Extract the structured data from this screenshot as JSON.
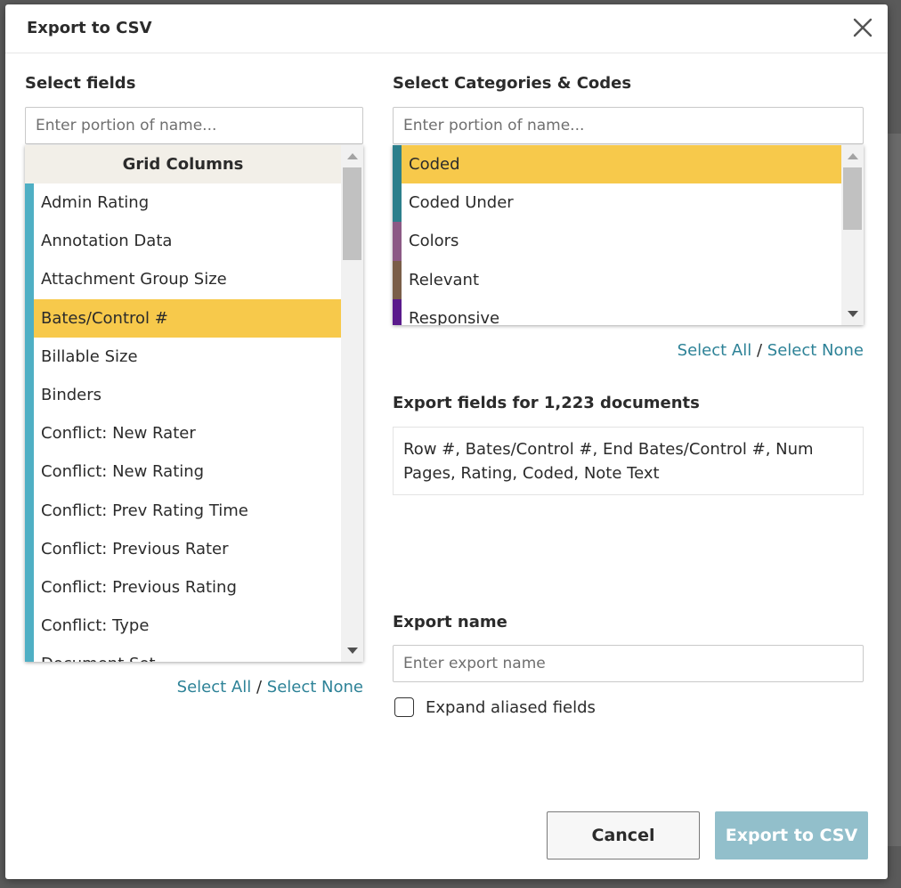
{
  "dialog": {
    "title": "Export to CSV",
    "close_icon": "close-icon"
  },
  "fields": {
    "label": "Select fields",
    "search_placeholder": "Enter portion of name...",
    "group_header": "Grid Columns",
    "accent_color": "#4fafc4",
    "selected_color": "#f7c94b",
    "items": [
      {
        "label": "Admin Rating",
        "selected": false
      },
      {
        "label": "Annotation Data",
        "selected": false
      },
      {
        "label": "Attachment Group Size",
        "selected": false
      },
      {
        "label": "Bates/Control #",
        "selected": true
      },
      {
        "label": "Billable Size",
        "selected": false
      },
      {
        "label": "Binders",
        "selected": false
      },
      {
        "label": "Conflict: New Rater",
        "selected": false
      },
      {
        "label": "Conflict: New Rating",
        "selected": false
      },
      {
        "label": "Conflict: Prev Rating Time",
        "selected": false
      },
      {
        "label": "Conflict: Previous Rater",
        "selected": false
      },
      {
        "label": "Conflict: Previous Rating",
        "selected": false
      },
      {
        "label": "Conflict: Type",
        "selected": false
      },
      {
        "label": "Document Set",
        "selected": false
      }
    ],
    "select_all": "Select All",
    "separator": "/",
    "select_none": "Select None"
  },
  "categories": {
    "label": "Select Categories & Codes",
    "search_placeholder": "Enter portion of name...",
    "items": [
      {
        "label": "Coded",
        "color": "#2c7f8c",
        "selected": true
      },
      {
        "label": "Coded Under",
        "color": "#2c7f8c",
        "selected": false
      },
      {
        "label": "Colors",
        "color": "#8c5a85",
        "selected": false
      },
      {
        "label": "Relevant",
        "color": "#7a5e49",
        "selected": false
      },
      {
        "label": "Responsive",
        "color": "#5a1a8c",
        "selected": false
      }
    ],
    "select_all": "Select All",
    "separator": "/",
    "select_none": "Select None"
  },
  "export_fields": {
    "label": "Export fields for 1,223 documents",
    "summary": "Row #, Bates/Control #, End Bates/Control #, Num Pages, Rating, Coded, Note Text"
  },
  "export_name": {
    "label": "Export name",
    "placeholder": "Enter export name",
    "value": ""
  },
  "expand_aliased": {
    "label": "Expand aliased fields",
    "checked": false
  },
  "buttons": {
    "cancel": "Cancel",
    "export": "Export to CSV"
  }
}
